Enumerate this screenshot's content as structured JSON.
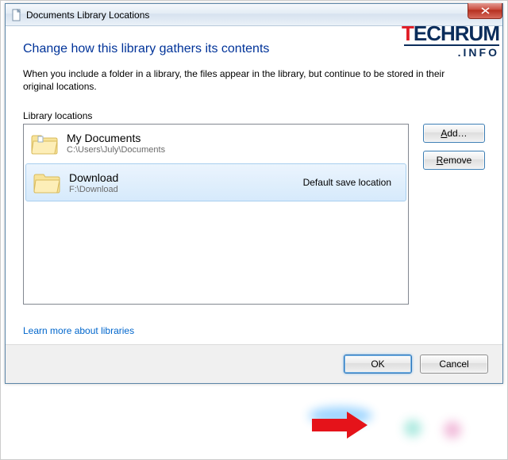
{
  "title": "Documents Library Locations",
  "heading": "Change how this library gathers its contents",
  "description": "When you include a folder in a library, the files appear in the library, but continue to be stored in their original locations.",
  "locations_label": "Library locations",
  "items": [
    {
      "name": "My Documents",
      "path": "C:\\Users\\July\\Documents",
      "default_label": ""
    },
    {
      "name": "Download",
      "path": "F:\\Download",
      "default_label": "Default save location"
    }
  ],
  "buttons": {
    "add": "Add…",
    "remove": "Remove",
    "ok": "OK",
    "cancel": "Cancel"
  },
  "link": "Learn more about libraries",
  "watermark": {
    "brand_t": "T",
    "brand_rest": "ECHRUM",
    "sub": ".INFO"
  }
}
